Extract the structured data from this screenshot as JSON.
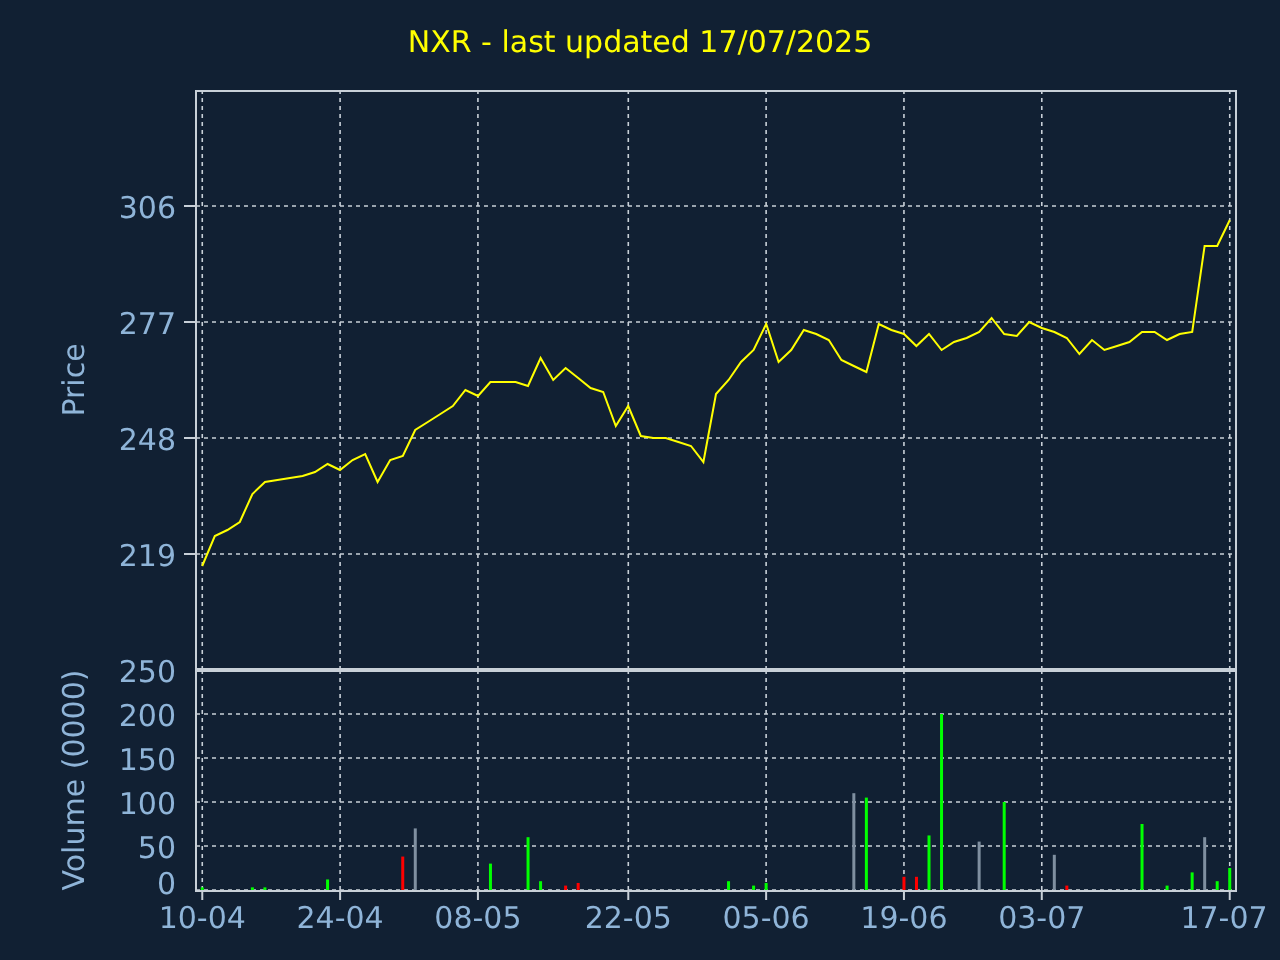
{
  "title": "NXR - last updated 17/07/2025",
  "price_chart": {
    "chart_data": {
      "type": "line",
      "grid": true,
      "ylabel": "Price",
      "ylim": [
        190,
        335
      ],
      "yticks": [
        219,
        248,
        277,
        306
      ],
      "series": [
        {
          "color": "#ffff00",
          "values": [
            216,
            223.5,
            225,
            227,
            234,
            237,
            237.5,
            238,
            238.5,
            239.5,
            241.5,
            240,
            242.5,
            244,
            237,
            242.5,
            243.5,
            250,
            252,
            254,
            256,
            260,
            258.5,
            262,
            262,
            262,
            261,
            268,
            262.5,
            265.5,
            263,
            260.5,
            259.5,
            251,
            256,
            248.5,
            248,
            248,
            247,
            246,
            242,
            259,
            262.5,
            267,
            270,
            276.5,
            267,
            270,
            275,
            274,
            272.5,
            267.5,
            266,
            264.5,
            276.5,
            275,
            274,
            271,
            274,
            270,
            272,
            273,
            274.5,
            278,
            274,
            273.5,
            277,
            275.5,
            274.5,
            273,
            269,
            272.5,
            270,
            271,
            272,
            274.5,
            274.5,
            272.5,
            274,
            274.5,
            296,
            296,
            302.5
          ]
        }
      ]
    }
  },
  "volume_chart": {
    "chart_data": {
      "type": "bar",
      "grid": true,
      "ylabel": "Volume (0000)",
      "ylim": [
        0,
        250
      ],
      "yticks": [
        0,
        50,
        100,
        150,
        200,
        250
      ],
      "categories": [
        "10-04",
        null,
        null,
        null,
        null,
        null,
        null,
        null,
        null,
        null,
        null,
        "24-04",
        null,
        null,
        null,
        null,
        null,
        null,
        null,
        null,
        null,
        null,
        "08-05",
        null,
        null,
        null,
        null,
        null,
        null,
        null,
        null,
        null,
        null,
        null,
        "22-05",
        null,
        null,
        null,
        null,
        null,
        null,
        null,
        null,
        null,
        null,
        "05-06",
        null,
        null,
        null,
        null,
        null,
        null,
        null,
        null,
        null,
        null,
        "19-06",
        null,
        null,
        null,
        null,
        null,
        null,
        null,
        null,
        null,
        null,
        "03-07",
        null,
        null,
        null,
        null,
        null,
        null,
        null,
        null,
        null,
        null,
        null,
        null,
        null,
        null,
        "17-07"
      ],
      "series": [
        {
          "color": "#00ff00",
          "values": [
            3,
            null,
            null,
            null,
            3,
            3,
            null,
            null,
            null,
            null,
            12,
            null,
            null,
            null,
            null,
            null,
            null,
            null,
            null,
            null,
            null,
            null,
            null,
            30,
            null,
            null,
            60,
            10,
            null,
            null,
            null,
            null,
            null,
            null,
            null,
            null,
            null,
            null,
            null,
            null,
            null,
            null,
            10,
            null,
            5,
            8,
            null,
            null,
            null,
            null,
            null,
            null,
            null,
            105,
            null,
            null,
            null,
            null,
            62,
            200,
            null,
            null,
            null,
            null,
            100,
            null,
            null,
            null,
            null,
            null,
            null,
            null,
            null,
            null,
            null,
            75,
            null,
            5,
            null,
            20,
            null,
            10,
            25
          ]
        },
        {
          "color": "#ff0000",
          "values": [
            null,
            null,
            null,
            null,
            null,
            null,
            null,
            null,
            null,
            null,
            null,
            null,
            null,
            null,
            null,
            null,
            38,
            null,
            null,
            null,
            null,
            null,
            null,
            null,
            null,
            null,
            null,
            null,
            null,
            5,
            8,
            null,
            null,
            null,
            null,
            null,
            null,
            null,
            null,
            null,
            null,
            null,
            null,
            null,
            null,
            null,
            null,
            null,
            null,
            null,
            null,
            null,
            null,
            null,
            null,
            null,
            15,
            15,
            null,
            null,
            null,
            null,
            null,
            null,
            null,
            null,
            null,
            null,
            null,
            5,
            null,
            null,
            null,
            null,
            null,
            null,
            null,
            null,
            null,
            null,
            null,
            null,
            null
          ]
        },
        {
          "color": "#7f8fa0",
          "values": [
            null,
            null,
            null,
            null,
            null,
            null,
            null,
            null,
            null,
            null,
            null,
            null,
            null,
            null,
            null,
            null,
            null,
            70,
            null,
            null,
            null,
            null,
            null,
            null,
            null,
            null,
            null,
            null,
            null,
            null,
            null,
            null,
            null,
            null,
            null,
            null,
            null,
            null,
            null,
            null,
            null,
            null,
            null,
            null,
            null,
            null,
            null,
            null,
            null,
            null,
            null,
            null,
            110,
            null,
            null,
            null,
            null,
            null,
            null,
            null,
            null,
            null,
            55,
            null,
            null,
            null,
            null,
            null,
            40,
            null,
            null,
            null,
            null,
            null,
            null,
            null,
            null,
            null,
            null,
            null,
            60,
            null,
            null
          ]
        }
      ]
    }
  }
}
